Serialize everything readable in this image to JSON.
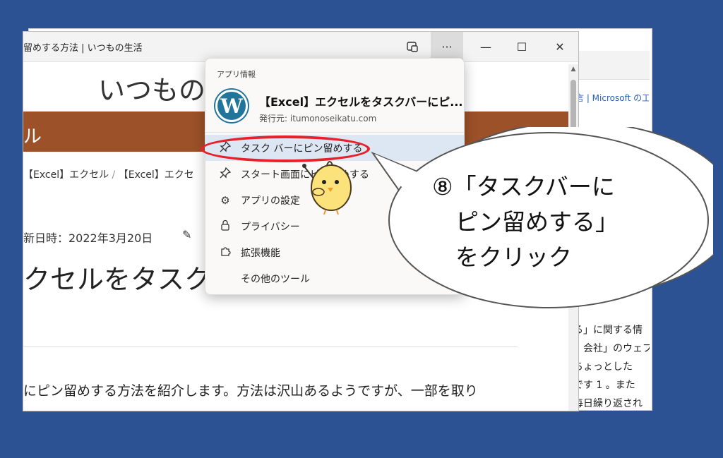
{
  "background_window": {
    "breadcrumb": "言 | Microsoft の工",
    "lines": [
      "る」に関する情",
      "」会社」のウェブ",
      "ちょっとした",
      "です 1 。また",
      "毎日繰り返され"
    ]
  },
  "app_window": {
    "title": "留めする方法 | いつもの生活",
    "controls": {
      "minimize": "—",
      "maximize": "☐",
      "close": "✕",
      "more": "···"
    },
    "page": {
      "site_title": "いつもの",
      "band_text": "ル",
      "breadcrumb_1": "【Excel】エクセル",
      "breadcrumb_sep": "/",
      "breadcrumb_2": "【Excel】エクセ",
      "updated": "新日時：2022年3月20日",
      "article_title": "クセルをタスク",
      "intro": "にピン留めする方法を紹介します。方法は沢山あるようですが、一部を取り"
    }
  },
  "menu": {
    "section_label": "アプリ情報",
    "app_name": "【Excel】エクセルをタスクバーにピ...",
    "publisher": "発行元: itumonoseikatu.com",
    "items": [
      {
        "label": "タスク バーにピン留めする",
        "icon": "pin-icon"
      },
      {
        "label": "スタート画面にピン留めする",
        "icon": "pin-icon"
      },
      {
        "label": "アプリの設定",
        "icon": "gear-icon"
      },
      {
        "label": "プライバシー",
        "icon": "lock-icon"
      },
      {
        "label": "拡張機能",
        "icon": "puzzle-icon"
      },
      {
        "label": "その他のツール",
        "icon": ""
      }
    ]
  },
  "callout": {
    "text": "⑧「タスクバーに\n　ピン留めする」\n　をクリック"
  },
  "colors": {
    "highlight": "#e8202a",
    "band": "#9c5128",
    "background": "#2c5293"
  }
}
